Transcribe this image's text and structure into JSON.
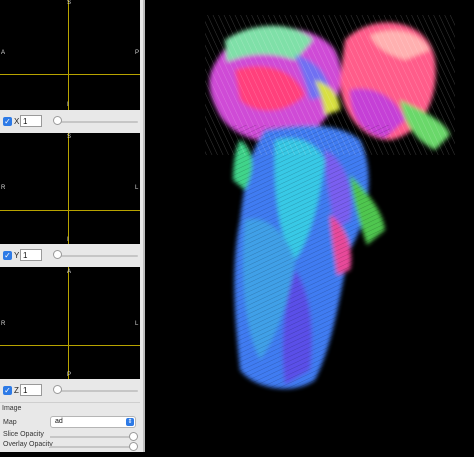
{
  "views": {
    "sagittal": {
      "top": "S",
      "left": "A",
      "right": "P",
      "bottom": "I"
    },
    "coronal": {
      "top": "S",
      "left": "R",
      "right": "L",
      "bottom": "I"
    },
    "axial": {
      "top": "A",
      "left": "R",
      "right": "L",
      "bottom": "P"
    }
  },
  "controls": {
    "x": {
      "label": "X",
      "value": "1",
      "checked": "✓"
    },
    "y": {
      "label": "Y",
      "value": "1",
      "checked": "✓"
    },
    "z": {
      "label": "Z",
      "value": "1",
      "checked": "✓"
    }
  },
  "image_panel": {
    "title": "Image",
    "map_label": "Map",
    "map_value": "ad",
    "slice_opacity_label": "Slice Opacity",
    "overlay_opacity_label": "Overlay Opacity"
  }
}
